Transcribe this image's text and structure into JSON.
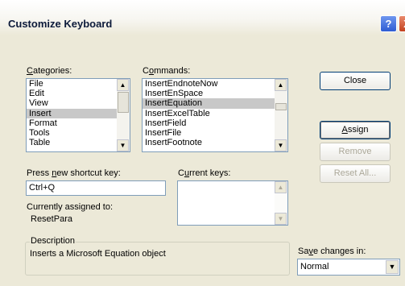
{
  "window": {
    "title": "Customize Keyboard",
    "help_glyph": "?",
    "close_glyph": "X"
  },
  "categories": {
    "label_prefix": "",
    "label_accel": "C",
    "label_rest": "ategories:",
    "items": [
      "File",
      "Edit",
      "View",
      "Insert",
      "Format",
      "Tools",
      "Table"
    ],
    "selected": "Insert"
  },
  "commands": {
    "label_prefix": "C",
    "label_accel": "o",
    "label_rest": "mmands:",
    "items": [
      "InsertEndnoteNow",
      "InsertEnSpace",
      "InsertEquation",
      "InsertExcelTable",
      "InsertField",
      "InsertFile",
      "InsertFootnote"
    ],
    "selected": "InsertEquation"
  },
  "shortcut": {
    "label_prefix": "Press ",
    "label_accel": "n",
    "label_rest": "ew shortcut key:",
    "value": "Ctrl+Q"
  },
  "current_keys": {
    "label_prefix": "C",
    "label_accel": "u",
    "label_rest": "rrent keys:"
  },
  "assigned": {
    "label": "Currently assigned to:",
    "value": "ResetPara"
  },
  "description": {
    "label": "Description",
    "text": "Inserts a Microsoft Equation object"
  },
  "save": {
    "label_prefix": "Sa",
    "label_accel": "v",
    "label_rest": "e changes in:",
    "value": "Normal"
  },
  "buttons": {
    "close": "Close",
    "assign_accel": "A",
    "assign_rest": "ssign",
    "remove": "Remove",
    "reset_all": "Reset All..."
  },
  "icons": {
    "scroll_up": "▲",
    "scroll_down": "▼"
  },
  "colors": {
    "dialog_bg": "#ece9d8",
    "selection": "#c8c8c8",
    "border": "#7f9db9",
    "disabled_text": "#aca899"
  }
}
